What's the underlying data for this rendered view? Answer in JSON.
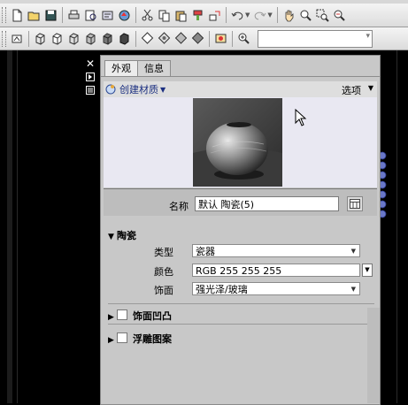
{
  "toolbar1": {
    "icons": [
      "new-file-icon",
      "open-folder-icon",
      "save-icon",
      "print-icon",
      "print-preview-icon",
      "publish-icon",
      "render-icon",
      "cut-icon",
      "copy-icon",
      "paste-icon",
      "match-properties-icon",
      "block-editor-icon",
      "undo-icon",
      "redo-icon",
      "pan-hand-icon",
      "zoom-realtime-icon",
      "zoom-window-icon",
      "zoom-previous-icon"
    ]
  },
  "toolbar2": {
    "icons": [
      "visual-style-2d-icon",
      "wireframe-icon",
      "hidden-icon",
      "realistic-icon",
      "conceptual-icon",
      "shaded-icon",
      "x-ray-icon",
      "shade-gouraud-icon",
      "material-sphere-icon",
      "edges-icon",
      "faces-icon",
      "render-crop-icon",
      "zoom-extents-icon"
    ]
  },
  "side_buttons": [
    "close-icon",
    "autohide-icon",
    "properties-menu-icon"
  ],
  "panel": {
    "tabs": [
      "外观",
      "信息"
    ],
    "active_tab": "外观",
    "create_label": "创建材质",
    "options_label": "选项",
    "name_label": "名称",
    "name_value": "默认 陶瓷(5)",
    "section_ceramic": "陶瓷",
    "type_label": "类型",
    "type_value": "瓷器",
    "color_label": "颜色",
    "color_value": "RGB 255 255 255",
    "finish_label": "饰面",
    "finish_value": "强光泽/玻璃",
    "section_finish_bumps": "饰面凹凸",
    "section_relief": "浮雕图案"
  }
}
